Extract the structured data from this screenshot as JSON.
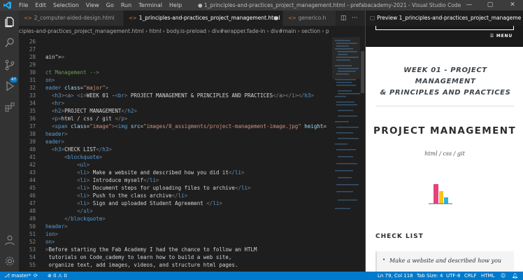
{
  "titlebar": {
    "menu": [
      "File",
      "Edit",
      "Selection",
      "View",
      "Go",
      "Run",
      "Terminal",
      "Help"
    ],
    "title": "● 1_principles-and-practices_project_management.html - prefabacademy-2021 - Visual Studio Code"
  },
  "activity_bar": {
    "badge": "47"
  },
  "tabs": [
    {
      "label": "2_computer-aided-design.html",
      "icon": "html-icon",
      "active": false
    },
    {
      "label": "1_principles-and-practices_project_management.html",
      "icon": "html-icon",
      "active": true,
      "dirty": "●"
    },
    {
      "label": "generico.h",
      "icon": "html-icon",
      "active": false
    }
  ],
  "breadcrumbs": "ciples-and-practices_project_management.html  ›  html  ›  body.is-preload  ›  div#wrapper.fade-in  ›  div#main  ›  section  ›  p",
  "code_lines": [
    {
      "n": "26",
      "html": ""
    },
    {
      "n": "27",
      "html": ""
    },
    {
      "n": "28",
      "html": "<span class='txt'>ain\"></span><span class='punct'>&gt;</span>"
    },
    {
      "n": "29",
      "html": ""
    },
    {
      "n": "30",
      "html": "<span class='cmt'>ct Management --&gt;</span>"
    },
    {
      "n": "31",
      "html": "<span class='tag'>on</span><span class='punct'>&gt;</span>"
    },
    {
      "n": "32",
      "html": "<span class='tag'>eader</span> <span class='attr'>class</span>=<span class='str'>\"major\"</span><span class='punct'>&gt;</span>"
    },
    {
      "n": "33",
      "html": "  <span class='punct'>&lt;</span><span class='tag'>h3</span><span class='punct'>&gt;&lt;</span><span class='tag'>a</span><span class='punct'>&gt;</span> <span class='punct'>&lt;</span><span class='tag'>i</span><span class='punct'>&gt;</span>WEEK 01 -<span class='punct'>&lt;</span><span class='tag'>br</span><span class='punct'>&gt;</span> PROJECT MANAGEMENT &amp; PRINCIPLES AND PRACTICES<span class='punct'>&lt;/</span><span class='tag'>a</span><span class='punct'>&gt;&lt;/</span><span class='tag'>i</span><span class='punct'>&gt;&lt;/</span><span class='tag'>h3</span><span class='punct'>&gt;</span>"
    },
    {
      "n": "34",
      "html": "  <span class='punct'>&lt;</span><span class='tag'>hr</span><span class='punct'>&gt;</span>"
    },
    {
      "n": "35",
      "html": "  <span class='punct'>&lt;</span><span class='tag'>h2</span><span class='punct'>&gt;</span>PROJECT MANAGEMENT<span class='punct'>&lt;/</span><span class='tag'>h2</span><span class='punct'>&gt;</span>"
    },
    {
      "n": "36",
      "html": "  <span class='punct'>&lt;</span><span class='tag'>p</span><span class='punct'>&gt;</span>html / css / git <span class='punct'>&lt;/</span><span class='tag'>p</span><span class='punct'>&gt;</span>"
    },
    {
      "n": "37",
      "html": "  <span class='punct'>&lt;</span><span class='tag'>span</span> <span class='attr'>class</span>=<span class='str'>\"image\"</span><span class='punct'>&gt;&lt;</span><span class='tag'>img</span> <span class='attr'>src</span>=<span class='str'>\"images/0_assigments/project-management-image.jpg\"</span> <span class='attr'>height</span>="
    },
    {
      "n": "38",
      "html": "<span class='tag'>header</span><span class='punct'>&gt;</span>"
    },
    {
      "n": "39",
      "html": "<span class='tag'>eader</span><span class='punct'>&gt;</span>"
    },
    {
      "n": "40",
      "html": "  <span class='punct'>&lt;</span><span class='tag'>h3</span><span class='punct'>&gt;</span>CHECK LIST<span class='punct'>&lt;/</span><span class='tag'>h3</span><span class='punct'>&gt;</span>"
    },
    {
      "n": "41",
      "html": "      <span class='punct'>&lt;</span><span class='tag'>blockquote</span><span class='punct'>&gt;</span>"
    },
    {
      "n": "42",
      "html": "          <span class='punct'>&lt;</span><span class='tag'>ul</span><span class='punct'>&gt;</span>"
    },
    {
      "n": "43",
      "html": "          <span class='punct'>&lt;</span><span class='tag'>li</span><span class='punct'>&gt;</span> Make a website and described how you did it<span class='punct'>&lt;/</span><span class='tag'>li</span><span class='punct'>&gt;</span>"
    },
    {
      "n": "44",
      "html": "          <span class='punct'>&lt;</span><span class='tag'>li</span><span class='punct'>&gt;</span> Introduce myself<span class='punct'>&lt;/</span><span class='tag'>li</span><span class='punct'>&gt;</span>"
    },
    {
      "n": "45",
      "html": "          <span class='punct'>&lt;</span><span class='tag'>li</span><span class='punct'>&gt;</span> Document steps for uploading files to archive<span class='punct'>&lt;/</span><span class='tag'>li</span><span class='punct'>&gt;</span>"
    },
    {
      "n": "46",
      "html": "          <span class='punct'>&lt;</span><span class='tag'>li</span><span class='punct'>&gt;</span> Push to the class archive<span class='punct'>&lt;/</span><span class='tag'>li</span><span class='punct'>&gt;</span>"
    },
    {
      "n": "47",
      "html": "          <span class='punct'>&lt;</span><span class='tag'>li</span><span class='punct'>&gt;</span> Sign and uploaded Student Agreement <span class='punct'>&lt;/</span><span class='tag'>li</span><span class='punct'>&gt;</span>"
    },
    {
      "n": "48",
      "html": "          <span class='punct'>&lt;/</span><span class='tag'>ul</span><span class='punct'>&gt;</span>"
    },
    {
      "n": "49",
      "html": "      <span class='punct'>&lt;/</span><span class='tag'>blockquote</span><span class='punct'>&gt;</span>"
    },
    {
      "n": "50",
      "html": "<span class='tag'>header</span><span class='punct'>&gt;</span>"
    },
    {
      "n": "51",
      "html": "<span class='tag'>ion</span><span class='punct'>&gt;</span>"
    },
    {
      "n": "52",
      "html": "<span class='tag'>on</span><span class='punct'>&gt;</span>"
    },
    {
      "n": "53",
      "html": "<span class='punct'>&gt;</span>Before starting the Fab Academy I had the chance to follow an HTLM"
    },
    {
      "n": "54",
      "html": " tutorials on Code_cademy to learn how to build a web site,"
    },
    {
      "n": "55",
      "html": " organize text, add images, videos, and structure html pages."
    }
  ],
  "preview": {
    "tab_label": "Preview 1_principles-and-practices_project_manageme",
    "menu_label": "MENU",
    "h1_line1": "WEEK 01 - PROJECT MANAGEMENT",
    "h1_line2": "& PRINCIPLES AND PRACTICES",
    "h2": "PROJECT MANAGEMENT",
    "subtitle": "html / css / git",
    "h3": "CHECK LIST",
    "list_item": "Make a website and described how you",
    "bar_colors": [
      "#e8417c",
      "#f5c518",
      "#2bb4d6"
    ]
  },
  "statusbar": {
    "branch": "master*",
    "errors": "0",
    "warnings": "0",
    "position": "Ln 79, Col 118",
    "tab_size": "Tab Size: 4",
    "encoding": "UTF-8",
    "eol": "CRLF",
    "language": "HTML"
  }
}
